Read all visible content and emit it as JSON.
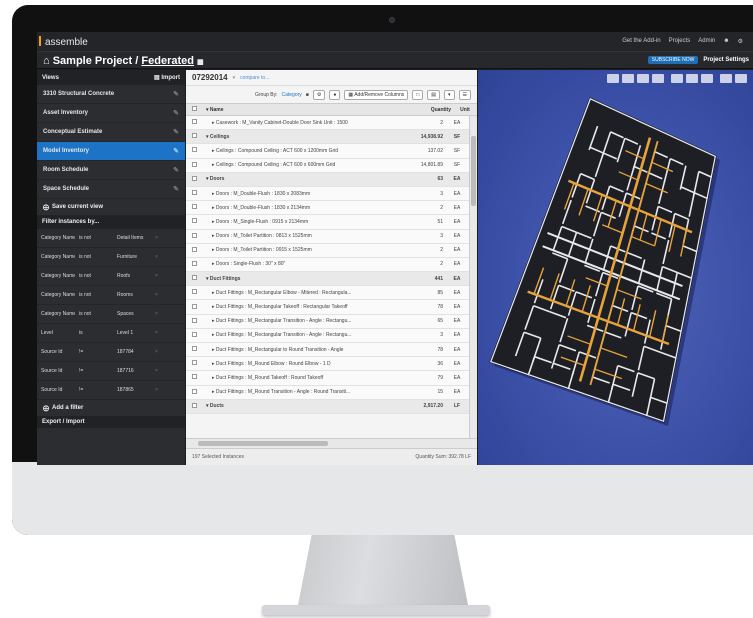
{
  "app": {
    "logo": "assemble",
    "top_nav": [
      "Get the Add-in",
      "Projects",
      "Admin"
    ],
    "user_icon": "user-icon",
    "settings_icon": "gear-icon"
  },
  "project": {
    "title_prefix": "Sample Project",
    "separator": "/",
    "model": "Federated",
    "badge": "SUBSCRIBE NOW",
    "settings_label": "Project Settings"
  },
  "sidebar": {
    "views_label": "Views",
    "import_label": "Import",
    "items": [
      {
        "label": "3310 Structural Concrete",
        "active": false
      },
      {
        "label": "Asset Inventory",
        "active": false
      },
      {
        "label": "Conceptual Estimate",
        "active": false
      },
      {
        "label": "Model Inventory",
        "active": true
      },
      {
        "label": "Room Schedule",
        "active": false
      },
      {
        "label": "Space Schedule",
        "active": false
      }
    ],
    "save_view": "Save current view",
    "filter_label": "Filter instances by...",
    "filters": [
      [
        "Category Name",
        "is not",
        "Detail Items"
      ],
      [
        "Category Name",
        "is not",
        "Furniture"
      ],
      [
        "Category Name",
        "is not",
        "Roofs"
      ],
      [
        "Category Name",
        "is not",
        "Rooms"
      ],
      [
        "Category Name",
        "is not",
        "Spaces"
      ],
      [
        "Level",
        "is",
        "Level 1"
      ],
      [
        "Source Id",
        "!=",
        "187784"
      ],
      [
        "Source Id",
        "!=",
        "187716"
      ],
      [
        "Source Id",
        "!=",
        "187865"
      ]
    ],
    "add_filter": "Add a filter",
    "export_label": "Export / Import"
  },
  "table": {
    "version_id": "07292014",
    "compare_link": "compare to...",
    "group_by_label": "Group By:",
    "group_by_value": "Category",
    "add_remove_columns": "Add/Remove Columns",
    "columns": {
      "name": "Name",
      "quantity": "Quantity",
      "unit": "Unit"
    },
    "rows": [
      {
        "group": false,
        "name": "▸ Casework : M_Vanity Cabinet-Double Door Sink Unit : 1500",
        "quantity": "2",
        "unit": "EA"
      },
      {
        "group": true,
        "name": "▾ Ceilings",
        "quantity": "14,938.92",
        "unit": "SF"
      },
      {
        "group": false,
        "name": "▸ Ceilings : Compound Ceiling : ACT 600 x 1200mm Grid",
        "quantity": "137.02",
        "unit": "SF"
      },
      {
        "group": false,
        "name": "▸ Ceilings : Compound Ceiling : ACT 600 x 600mm Grid",
        "quantity": "14,801.89",
        "unit": "SF"
      },
      {
        "group": true,
        "name": "▾ Doors",
        "quantity": "63",
        "unit": "EA"
      },
      {
        "group": false,
        "name": "▸ Doors : M_Double-Flush : 1830 x 2083mm",
        "quantity": "3",
        "unit": "EA"
      },
      {
        "group": false,
        "name": "▸ Doors : M_Double-Flush : 1830 x 2134mm",
        "quantity": "2",
        "unit": "EA"
      },
      {
        "group": false,
        "name": "▸ Doors : M_Single-Flush : 0915 x 2134mm",
        "quantity": "51",
        "unit": "EA"
      },
      {
        "group": false,
        "name": "▸ Doors : M_Toilet Partition : 0813 x 1525mm",
        "quantity": "3",
        "unit": "EA"
      },
      {
        "group": false,
        "name": "▸ Doors : M_Toilet Partition : 0915 x 1525mm",
        "quantity": "2",
        "unit": "EA"
      },
      {
        "group": false,
        "name": "▸ Doors : Single-Flush : 30\" x 80\"",
        "quantity": "2",
        "unit": "EA"
      },
      {
        "group": true,
        "name": "▾ Duct Fittings",
        "quantity": "441",
        "unit": "EA"
      },
      {
        "group": false,
        "name": "▸ Duct Fittings : M_Rectangular Elbow - Mitered : Rectangula...",
        "quantity": "85",
        "unit": "EA"
      },
      {
        "group": false,
        "name": "▸ Duct Fittings : M_Rectangular Takeoff : Rectangular Takeoff",
        "quantity": "78",
        "unit": "EA"
      },
      {
        "group": false,
        "name": "▸ Duct Fittings : M_Rectangular Transition - Angle : Rectangu...",
        "quantity": "65",
        "unit": "EA"
      },
      {
        "group": false,
        "name": "▸ Duct Fittings : M_Rectangular Transition - Angle : Rectangu...",
        "quantity": "3",
        "unit": "EA"
      },
      {
        "group": false,
        "name": "▸ Duct Fittings : M_Rectangular to Round Transition - Angle",
        "quantity": "78",
        "unit": "EA"
      },
      {
        "group": false,
        "name": "▸ Duct Fittings : M_Round Elbow : Round Elbow - 1 D",
        "quantity": "36",
        "unit": "EA"
      },
      {
        "group": false,
        "name": "▸ Duct Fittings : M_Round Takeoff : Round Takeoff",
        "quantity": "79",
        "unit": "EA"
      },
      {
        "group": false,
        "name": "▸ Duct Fittings : M_Round Transition - Angle : Round Transiti...",
        "quantity": "15",
        "unit": "EA"
      },
      {
        "group": true,
        "name": "▾ Ducts",
        "quantity": "2,917.20",
        "unit": "LF"
      }
    ],
    "footer_selected": "197 Selected Instances",
    "footer_sum": "Quantity Sum: 392.78 LF"
  },
  "colors": {
    "accent": "#1d74c6",
    "viewer_bg": "#3a4fa6",
    "duct": "#e8a43a"
  }
}
